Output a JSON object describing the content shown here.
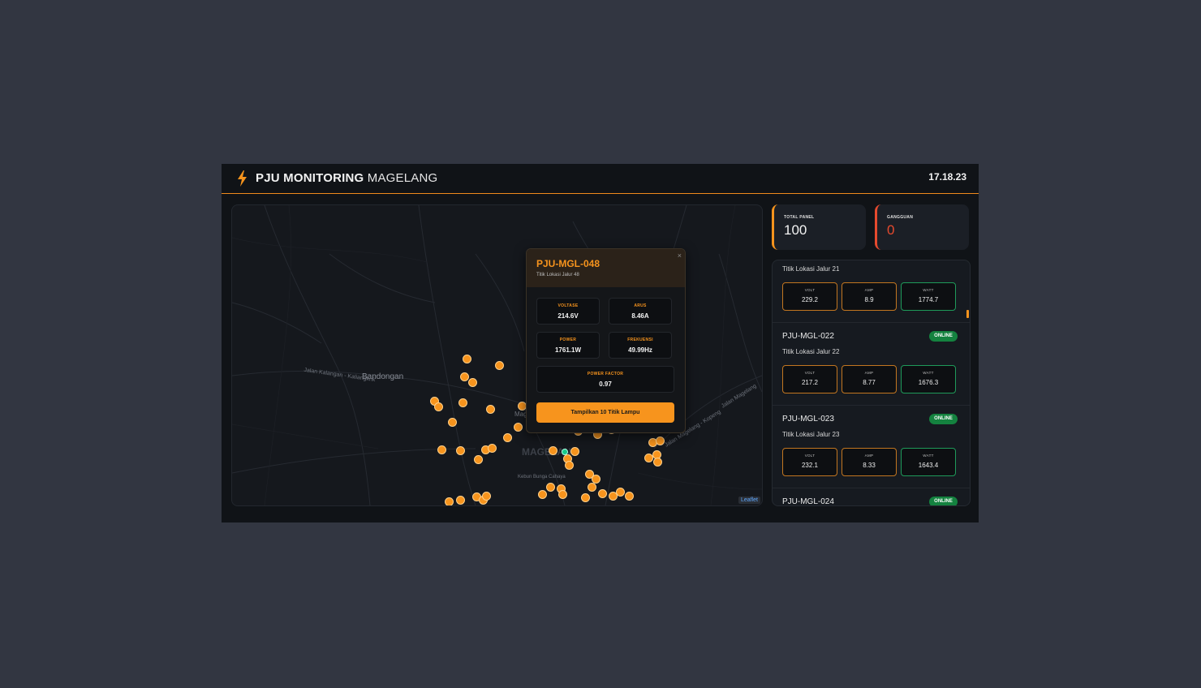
{
  "header": {
    "title_bold": "PJU MONITORING",
    "title_rest": "MAGELANG",
    "clock": "17.18.23",
    "brand_icon": "lightning-bolt-icon",
    "accent_color": "#f7941d"
  },
  "map": {
    "labels": {
      "bandongan": "Bandongan",
      "road_1": "Jalan Kalangan - Kaliangkrik",
      "magelang": "Magelang",
      "magelang_big": "MAGELANG",
      "road_2": "Jalan Magelang - Kopeng",
      "road_3": "Jalan Magelang",
      "area": "Kebun Bunga Cahaya"
    },
    "attribution": "Leaflet",
    "marker_color": "#f7941d",
    "active_marker_color": "#18c98a"
  },
  "popup": {
    "id": "PJU-MGL-048",
    "location": "Titik Lokasi Jalur 48",
    "close": "×",
    "metrics": {
      "voltase_label": "VOLTASE",
      "voltase_value": "214.6V",
      "arus_label": "ARUS",
      "arus_value": "8.46A",
      "power_label": "POWER",
      "power_value": "1761.1W",
      "frekuensi_label": "FREKUENSI",
      "frekuensi_value": "49.99Hz",
      "pf_label": "POWER FACTOR",
      "pf_value": "0.97"
    },
    "button": "Tampilkan 10 Titik Lampu"
  },
  "stats": {
    "total_label": "TOTAL PANEL",
    "total_value": "100",
    "gangguan_label": "GANGGUAN",
    "gangguan_value": "0",
    "danger_color": "#e64a2e"
  },
  "list": {
    "status_color": "#14823f",
    "items": [
      {
        "id": "",
        "location": "Titik Lokasi Jalur 21",
        "status": "",
        "volt_label": "VOLT",
        "volt": "229.2",
        "amp_label": "AMP",
        "amp": "8.9",
        "watt_label": "WATT",
        "watt": "1774.7"
      },
      {
        "id": "PJU-MGL-022",
        "location": "Titik Lokasi Jalur 22",
        "status": "ONLINE",
        "volt_label": "VOLT",
        "volt": "217.2",
        "amp_label": "AMP",
        "amp": "8.77",
        "watt_label": "WATT",
        "watt": "1676.3"
      },
      {
        "id": "PJU-MGL-023",
        "location": "Titik Lokasi Jalur 23",
        "status": "ONLINE",
        "volt_label": "VOLT",
        "volt": "232.1",
        "amp_label": "AMP",
        "amp": "8.33",
        "watt_label": "WATT",
        "watt": "1643.4"
      },
      {
        "id": "PJU-MGL-024",
        "location": "",
        "status": "ONLINE"
      }
    ]
  }
}
